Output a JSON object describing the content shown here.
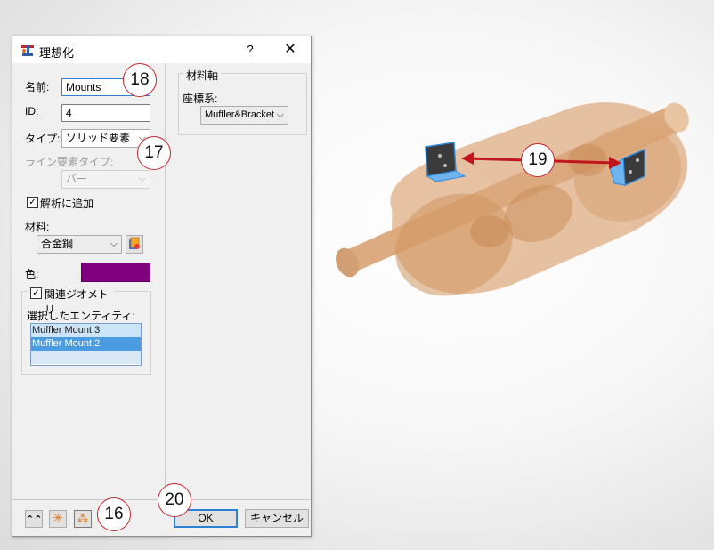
{
  "dialog": {
    "title": "理想化",
    "help_label": "?",
    "close_label": "✕",
    "name_label": "名前:",
    "name_value": "Mounts",
    "id_label": "ID:",
    "id_value": "4",
    "type_label": "タイプ:",
    "type_value": "ソリッド要素",
    "line_type_label": "ライン要素タイプ:",
    "line_type_value": "バー",
    "add_to_analysis_label": "解析に追加",
    "add_to_analysis_checked": true,
    "material_label": "材料:",
    "material_value": "合金鋼",
    "color_label": "色:",
    "color_value": "#800080",
    "related_geometry_label": "関連ジオメトリ",
    "related_geometry_checked": true,
    "selected_entities_label": "選択したエンティティ:",
    "selected_entities": [
      "Muffler Mount:3",
      "Muffler Mount:2"
    ],
    "material_axis_group": "材料軸",
    "coord_system_label": "座標系:",
    "coord_system_value": "Muffler&Bracket",
    "ok_label": "OK",
    "cancel_label": "キャンセル"
  },
  "callouts": {
    "c16": "16",
    "c17": "17",
    "c18": "18",
    "c19": "19",
    "c20": "20"
  },
  "icons": {
    "app": "idealize-icon",
    "collapse": "double-chevron-up-icon",
    "highlight": "sparkle-icon",
    "highlight2": "sparkle-frame-icon",
    "material_browse": "material-library-icon"
  },
  "colors": {
    "accent": "#2f7fd3",
    "callout_border": "#c0272d",
    "arrow": "#c0151c",
    "part": "#d9a06e"
  }
}
